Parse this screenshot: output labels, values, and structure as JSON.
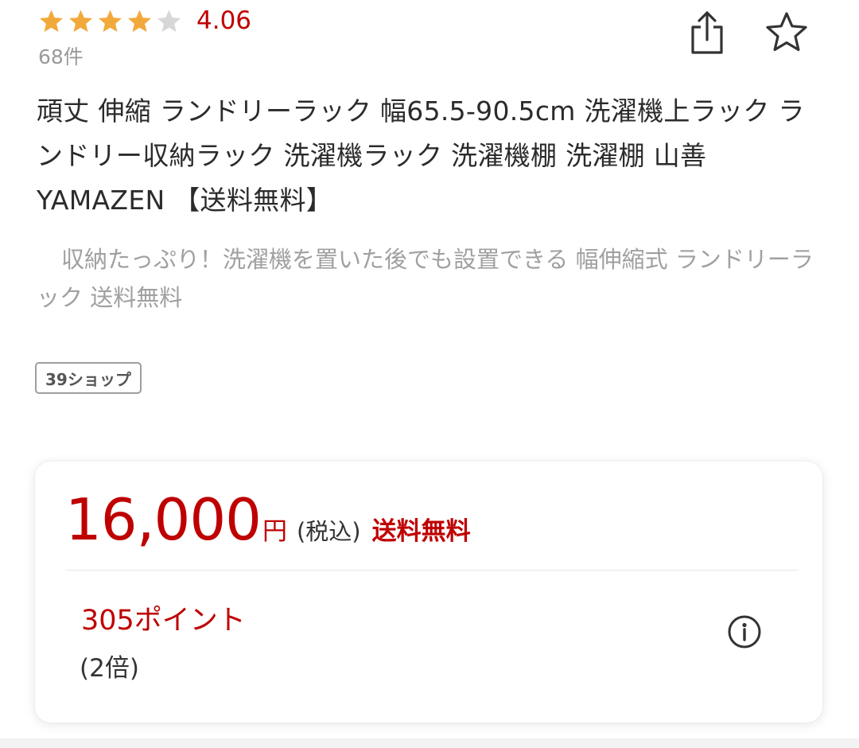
{
  "rating": {
    "value": "4.06",
    "score": 4.06,
    "max": 5,
    "count_text": "68件",
    "star_color": "#f2a93b",
    "star_empty_color": "#d7d7d7"
  },
  "actions": {
    "share_icon": "share-icon",
    "favorite_icon": "star-outline-icon"
  },
  "product": {
    "title": "頑丈 伸縮 ランドリーラック 幅65.5-90.5cm 洗濯機上ラック ランドリー収納ラック 洗濯機ラック 洗濯機棚 洗濯棚 山善 YAMAZEN 【送料無料】",
    "catch_copy": "収納たっぷり！洗濯機を置いた後でも設置できる 幅伸縮式 ランドリーラック 送料無料",
    "shop_badge": "39ショップ"
  },
  "price": {
    "amount": "16,000",
    "currency": "円",
    "tax_note": "(税込)",
    "shipping": "送料無料",
    "accent_color": "#bf0000"
  },
  "points": {
    "text": "305ポイント",
    "multiplier": "(2倍)",
    "info_icon": "info-icon"
  }
}
